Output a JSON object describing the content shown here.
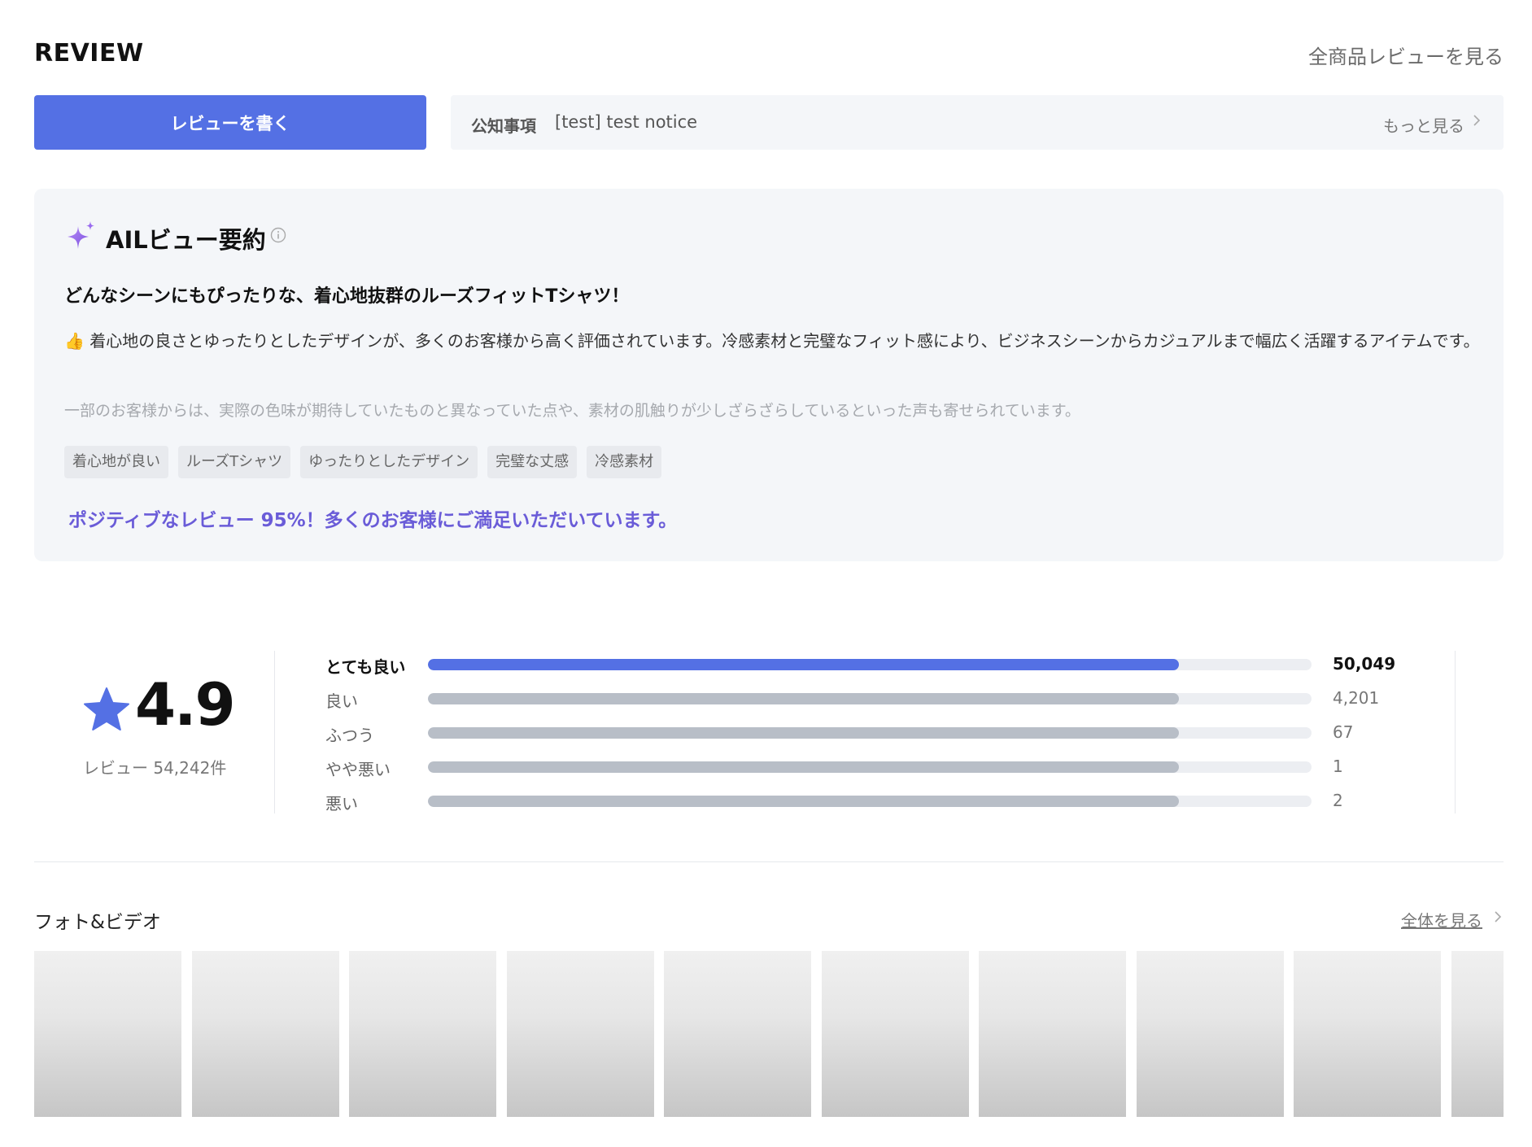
{
  "header": {
    "title": "REVIEW",
    "all_reviews_link": "全商品レビューを見る"
  },
  "actions": {
    "write_review": "レビューを書く"
  },
  "notice": {
    "label": "公知事項",
    "text": "[test] test notice",
    "more": "もっと見る"
  },
  "ai_summary": {
    "title": "AILビュー要約",
    "headline": "どんなシーンにもぴったりな、着心地抜群のルーズフィットTシャツ！",
    "positive": "👍 着心地の良さとゆったりとしたデザインが、多くのお客様から高く評価されています。冷感素材と完璧なフィット感により、ビジネスシーンからカジュアルまで幅広く活躍するアイテムです。",
    "negative": "一部のお客様からは、実際の色味が期待していたものと異なっていた点や、素材の肌触りが少しざらざらしているといった声も寄せられています。",
    "keywords": [
      "着心地が良い",
      "ルーズTシャツ",
      "ゆったりとしたデザイン",
      "完璧な丈感",
      "冷感素材"
    ],
    "satisfaction": "ポジティブなレビュー 95%！多くのお客様にご満足いただいています。"
  },
  "rating": {
    "score": "4.9",
    "review_count_label": "レビュー 54,242件",
    "distribution": [
      {
        "label": "とても良い",
        "count": "50,049",
        "fill_fraction": 0.85,
        "highlight": true
      },
      {
        "label": "良い",
        "count": "4,201",
        "fill_fraction": 0.85,
        "highlight": false
      },
      {
        "label": "ふつう",
        "count": "67",
        "fill_fraction": 0.85,
        "highlight": false
      },
      {
        "label": "やや悪い",
        "count": "1",
        "fill_fraction": 0.85,
        "highlight": false
      },
      {
        "label": "悪い",
        "count": "2",
        "fill_fraction": 0.85,
        "highlight": false
      }
    ]
  },
  "photos": {
    "title": "フォト&ビデオ",
    "see_all": "全体を見る",
    "thumbnail_count": 10
  },
  "colors": {
    "accent": "#5470e4",
    "ai_purple": "#6a5cd8",
    "card_bg": "#f4f6f9",
    "bar_gray": "#b8bec7"
  }
}
